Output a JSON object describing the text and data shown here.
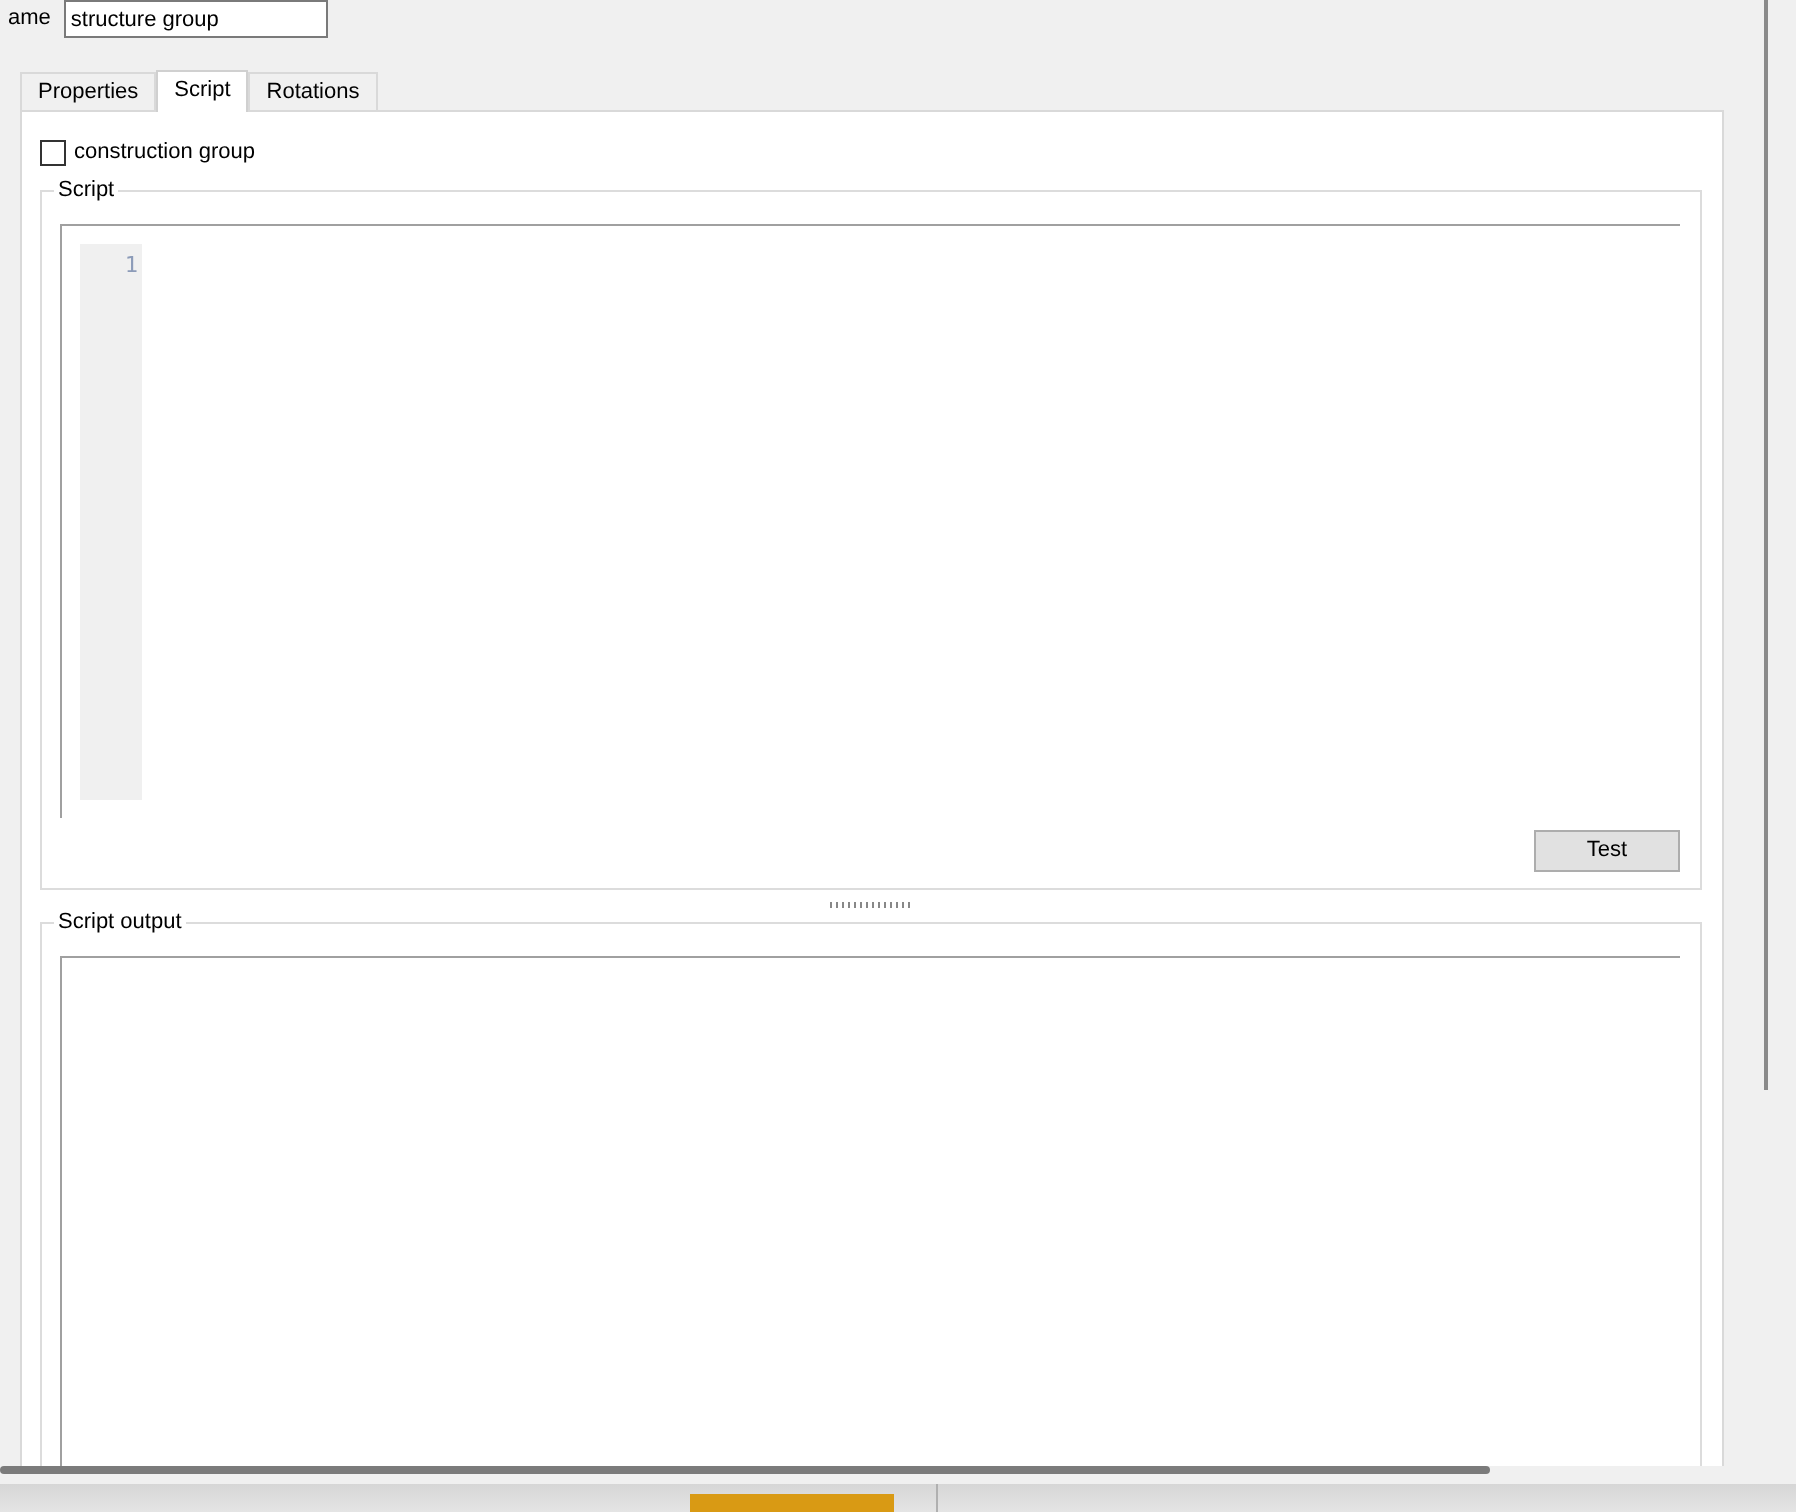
{
  "name_field": {
    "label": "ame",
    "value": "structure group"
  },
  "tabs": [
    {
      "label": "Properties",
      "selected": false
    },
    {
      "label": "Script",
      "selected": true
    },
    {
      "label": "Rotations",
      "selected": false
    }
  ],
  "construction_group": {
    "label": "construction group",
    "checked": false
  },
  "script_group": {
    "title": "Script",
    "line_numbers": [
      "1"
    ],
    "button": "Test"
  },
  "output_group": {
    "title": "Script output"
  }
}
